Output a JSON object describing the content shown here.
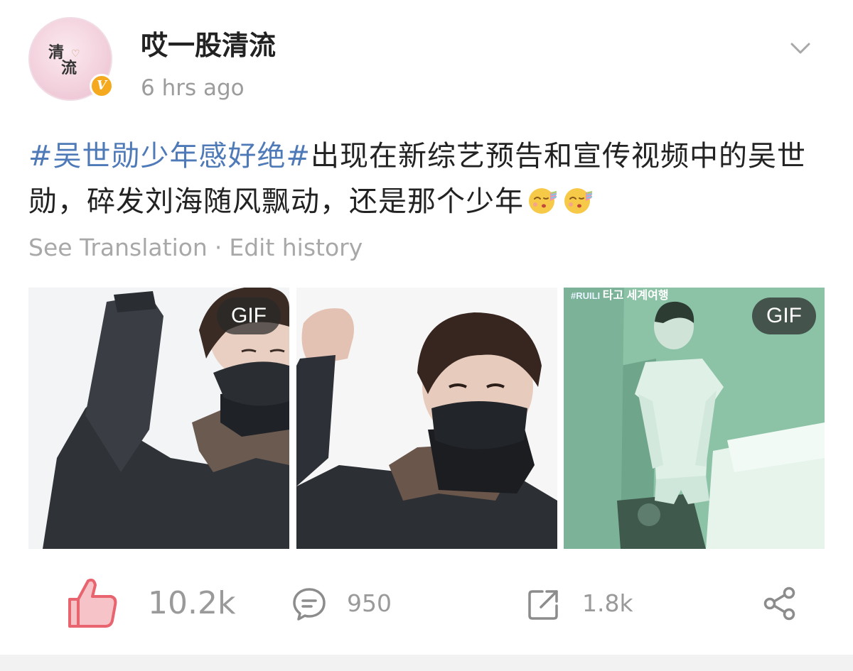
{
  "post": {
    "author": {
      "name": "哎一股清流",
      "avatar_text": [
        "清",
        "流"
      ],
      "verified_label": "V"
    },
    "timestamp": "6 hrs ago",
    "hashtag": "#吴世勋少年感好绝#",
    "body": "出现在新综艺预告和宣传视频中的吴世勋，碎发刘海随风飘动，还是那个少年",
    "emoji_count": 2,
    "see_translation": "See Translation",
    "separator": "·",
    "edit_history": "Edit history"
  },
  "media": [
    {
      "badge": "GIF"
    },
    {
      "badge": ""
    },
    {
      "badge": "GIF",
      "watermark_tag": "#RUILI",
      "watermark_text": "타고 세계여행"
    }
  ],
  "actions": {
    "like_count": "10.2k",
    "comment_count": "950",
    "repost_count": "1.8k"
  },
  "colors": {
    "hashtag": "#4f7ab8",
    "like_icon": "#e8646e",
    "verified_badge": "#f4a91f",
    "meta_text": "#a8a8a8",
    "count_text": "#9a9a9a"
  },
  "icons": [
    "chevron-down-icon",
    "like-thumb-icon",
    "comment-icon",
    "repost-icon",
    "share-icon",
    "kiss-emoji-icon"
  ]
}
